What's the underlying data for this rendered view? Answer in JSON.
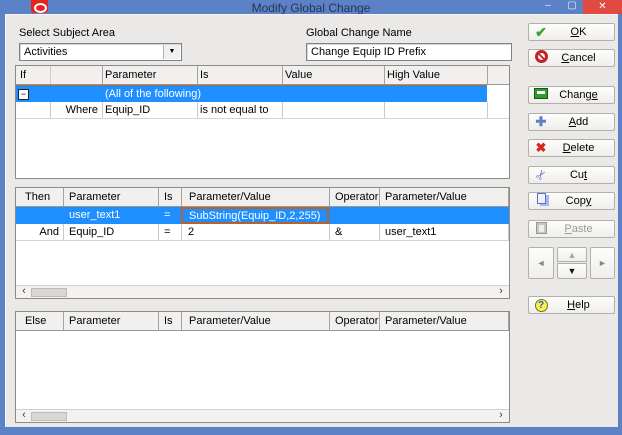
{
  "colors": {
    "titlebar": "#5b82c6",
    "selection": "#1f8fff",
    "focus_border": "#b5622d",
    "close_red": "#e04a40",
    "dialog_bg": "#ebe9e8"
  },
  "window": {
    "title": "Modify Global Change",
    "minimize_glyph": "–",
    "maximize_glyph": "▢",
    "close_glyph": "✕"
  },
  "form": {
    "subject_area_label": "Select Subject Area",
    "subject_area_value": "Activities",
    "change_name_label": "Global Change Name",
    "change_name_value": "Change Equip ID Prefix"
  },
  "if_table": {
    "columns": [
      "If",
      "Parameter",
      "Is",
      "Value",
      "High Value"
    ],
    "rows": [
      {
        "if": "",
        "parameter": "(All of the following)",
        "is": "",
        "value": "",
        "high_value": "",
        "expander": "−",
        "selected": true
      },
      {
        "if": "Where",
        "parameter": "Equip_ID",
        "is": "is not equal to",
        "value": "",
        "high_value": "",
        "selected": false
      }
    ]
  },
  "then_table": {
    "columns": [
      "Then",
      "Parameter",
      "Is",
      "Parameter/Value",
      "Operator",
      "Parameter/Value"
    ],
    "rows": [
      {
        "then": "",
        "parameter": "user_text1",
        "is": "=",
        "value1": "SubString(Equip_ID,2,255)",
        "operator": "",
        "value2": "",
        "selected": true,
        "focused_cell": "value1"
      },
      {
        "then": "And",
        "parameter": "Equip_ID",
        "is": "=",
        "value1": "2",
        "operator": "&",
        "value2": "user_text1",
        "selected": false
      }
    ]
  },
  "else_table": {
    "columns": [
      "Else",
      "Parameter",
      "Is",
      "Parameter/Value",
      "Operator",
      "Parameter/Value"
    ],
    "rows": []
  },
  "buttons": {
    "ok": {
      "pre": "",
      "key": "O",
      "post": "K"
    },
    "cancel": {
      "pre": "",
      "key": "C",
      "post": "ancel"
    },
    "change": {
      "pre": "Chang",
      "key": "e",
      "post": ""
    },
    "add": {
      "pre": "",
      "key": "A",
      "post": "dd"
    },
    "delete": {
      "pre": "",
      "key": "D",
      "post": "elete"
    },
    "cut": {
      "pre": "Cu",
      "key": "t",
      "post": ""
    },
    "copy": {
      "pre": "Cop",
      "key": "y",
      "post": ""
    },
    "paste": {
      "pre": "",
      "key": "P",
      "post": "aste"
    },
    "help": {
      "pre": "",
      "key": "H",
      "post": "elp"
    }
  },
  "icons": {
    "dropdown": "▼",
    "scroll_left": "‹",
    "scroll_right": "›",
    "arrow_left": "◄",
    "arrow_right": "►",
    "arrow_up": "▲",
    "arrow_down": "▼",
    "check": "✔",
    "add": "✚",
    "delete": "✖",
    "cut": "✂",
    "help": "?"
  }
}
